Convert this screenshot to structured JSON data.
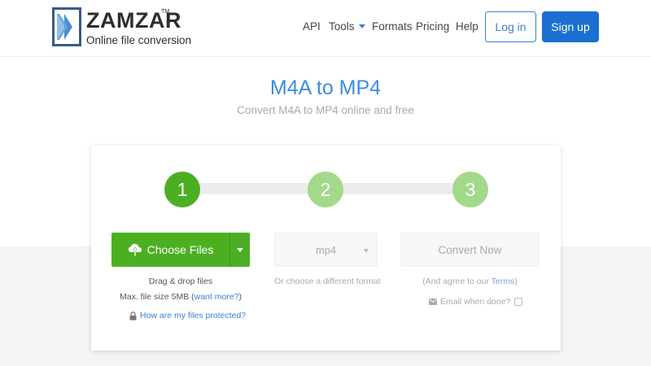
{
  "header": {
    "logo_name": "ZAMZAR",
    "logo_tm": "TM",
    "logo_tagline": "Online file conversion",
    "nav": {
      "api": "API",
      "tools": "Tools",
      "formats": "Formats",
      "pricing": "Pricing",
      "help": "Help"
    },
    "login_label": "Log in",
    "signup_label": "Sign up"
  },
  "hero": {
    "title": "M4A to MP4",
    "subtitle": "Convert M4A to MP4 online and free"
  },
  "converter": {
    "steps": [
      "1",
      "2",
      "3"
    ],
    "choose_files_label": "Choose Files",
    "drag_drop_text": "Drag & drop files",
    "max_size_text": "Max. file size 5MB (",
    "want_more_link": "want more?",
    "max_size_close": ")",
    "protected_link": "How are my files protected?",
    "format_value": "mp4",
    "format_hint": "Or choose a different format",
    "convert_label": "Convert Now",
    "agree_prefix": "(And agree to our ",
    "terms_link": "Terms",
    "agree_suffix": ")",
    "email_label": "Email when done?"
  },
  "colors": {
    "brand_blue": "#1b6fd1",
    "title_blue": "#3a8ee0",
    "step_green": "#4caf22",
    "step_green_light": "#a3d98a"
  },
  "icons": {
    "logo": "zamzar-chevron-logo-icon",
    "upload": "cloud-upload-icon",
    "lock": "lock-icon",
    "email": "envelope-icon",
    "dropdown": "caret-down-icon"
  }
}
